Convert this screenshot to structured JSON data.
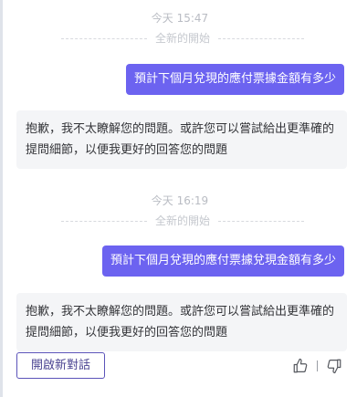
{
  "conversations": [
    {
      "timestamp": "今天 15:47",
      "divider": "全新的開始",
      "user_message": "預計下個月兌現的應付票據金額有多少",
      "bot_reply": "抱歉，我不太瞭解您的問題。或許您可以嘗試給出更準確的提問細節，以便我更好的回答您的問題"
    },
    {
      "timestamp": "今天 16:19",
      "divider": "全新的開始",
      "user_message": "預計下個月兌現的應付票據兌現金額有多少",
      "bot_reply": "抱歉，我不太瞭解您的問題。或許您可以嘗試給出更準確的提問細節，以便我更好的回答您的問題"
    }
  ],
  "actions": {
    "new_chat_label": "開啟新對話"
  },
  "icons": {
    "like": "thumbs-up-icon",
    "dislike": "thumbs-down-icon"
  },
  "colors": {
    "user_bubble": "#6c63f0",
    "bot_bubble": "#f4f5f7",
    "button_border": "#5b53b9"
  }
}
